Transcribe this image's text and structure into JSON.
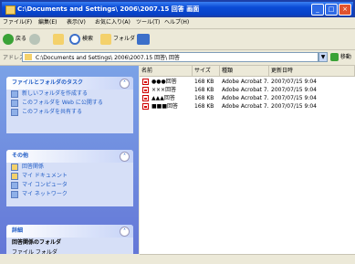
{
  "window": {
    "title": "C:\\Documents and Settings\\ 2006\\2007.15 回答 画面",
    "buttons": [
      "_",
      "□",
      "×"
    ]
  },
  "menubar": [
    "ファイル(F)",
    "編集(E)",
    "表示(V)",
    "お気に入り(A)",
    "ツール(T)",
    "ヘルプ(H)"
  ],
  "toolbar": {
    "back_label": "戻る",
    "forward_label": "",
    "search_label": "検索",
    "folders_label": "フォルダ"
  },
  "address": {
    "label": "アドレス(D)",
    "value": "C:\\Documents and Settings\\ 2006\\2007.15 回答\\ 回答",
    "go_label": "移動"
  },
  "left_panels": [
    {
      "title": "ファイルとフォルダのタスク",
      "items": [
        "新しいフォルダを作成する",
        "このフォルダを Web に公開する",
        "このフォルダを共有する"
      ]
    },
    {
      "title": "その他",
      "items": [
        "回答関係",
        "マイ ドキュメント",
        "マイ コンピュータ",
        "マイ ネットワーク"
      ]
    },
    {
      "title": "詳細",
      "details": [
        "回答関係のフォルダ",
        "ファイル フォルダ"
      ]
    }
  ],
  "columns": [
    "名前",
    "サイズ",
    "種類",
    "更新日時"
  ],
  "files": [
    {
      "name": "●●●回答",
      "size": "168 KB",
      "type": "Adobe Acrobat 7.0 ...",
      "modified": "2007/07/15 9:04"
    },
    {
      "name": "×××回答",
      "size": "168 KB",
      "type": "Adobe Acrobat 7.0 ...",
      "modified": "2007/07/15 9:04"
    },
    {
      "name": "▲▲▲回答",
      "size": "168 KB",
      "type": "Adobe Acrobat 7.0 ...",
      "modified": "2007/07/15 9:04"
    },
    {
      "name": "■■■回答",
      "size": "168 KB",
      "type": "Adobe Acrobat 7.0 ...",
      "modified": "2007/07/15 9:04"
    }
  ]
}
